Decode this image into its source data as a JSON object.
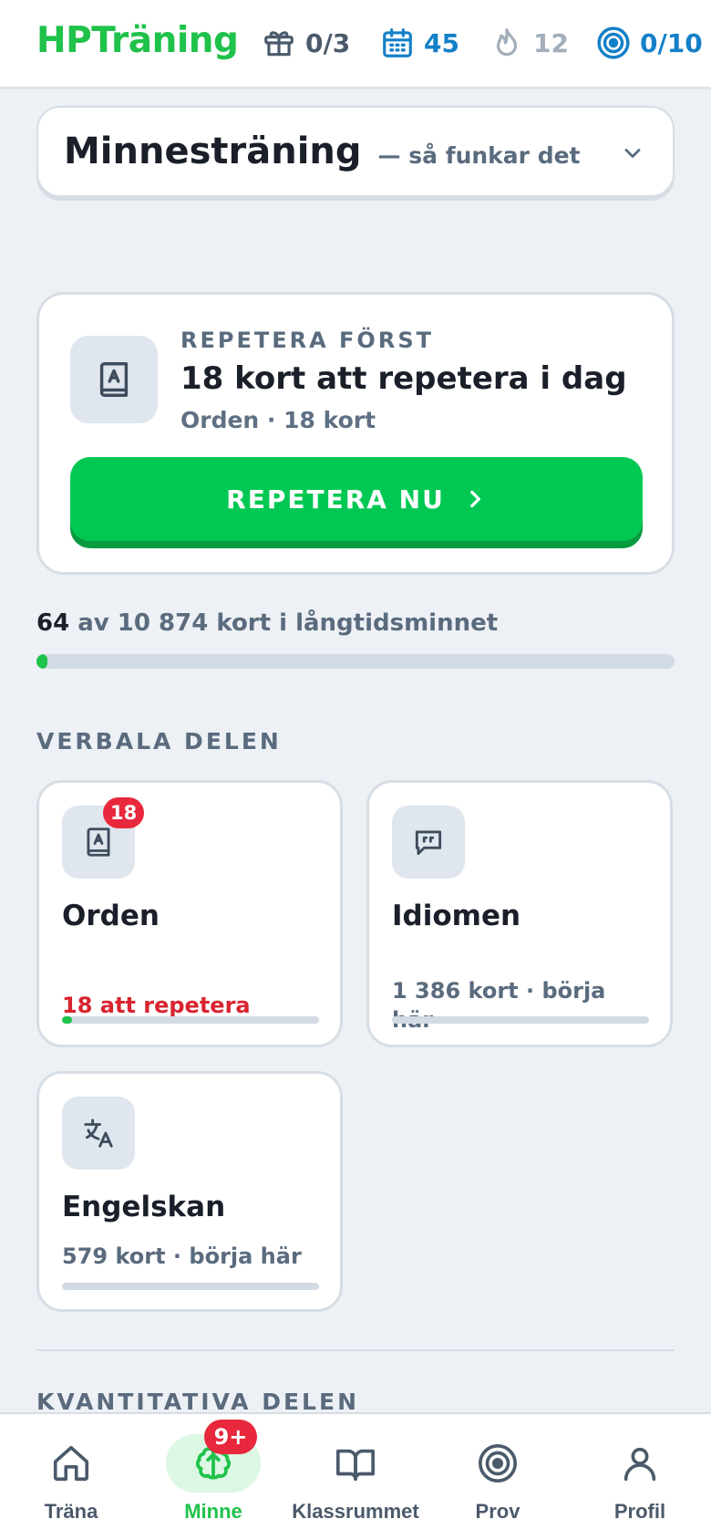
{
  "header": {
    "brand": "HPTräning",
    "stats": {
      "gifts": "0/3",
      "calendar": "45",
      "streak": "12",
      "goal": "0/10"
    },
    "icons": {
      "gifts": "gift-icon",
      "calendar": "calendar-icon",
      "streak": "flame-icon",
      "goal": "target-icon"
    }
  },
  "intro": {
    "title": "Minnesträning",
    "subtitle": "— så funkar det",
    "toggle_icon": "chevron-down-icon"
  },
  "review": {
    "kicker": "REPETERA FÖRST",
    "title": "18 kort att repetera i dag",
    "meta": "Orden · 18 kort",
    "button_label": "REPETERA NU",
    "icon": "book-icon",
    "button_icon": "chevron-right-icon"
  },
  "longterm": {
    "count": "64",
    "text": "av 10 874 kort i långtidsminnet",
    "progress": 0.006
  },
  "sections": {
    "verbal": "VERBALA DELEN",
    "quant": "KVANTITATIVA DELEN"
  },
  "decks": [
    {
      "title": "Orden",
      "status": "18 att repetera",
      "badge": "18",
      "progress": 0.04,
      "icon": "book-icon"
    },
    {
      "title": "Idiomen",
      "status": "1 386 kort · börja här",
      "progress": 0,
      "icon": "quote-bubble-icon"
    },
    {
      "title": "Engelskan",
      "status": "579 kort · börja här",
      "progress": 0,
      "icon": "translate-icon"
    }
  ],
  "nav": {
    "items": [
      {
        "label": "Träna",
        "icon": "home-icon"
      },
      {
        "label": "Minne",
        "icon": "brain-icon",
        "badge": "9+",
        "active": true
      },
      {
        "label": "Klassrummet",
        "icon": "open-book-icon"
      },
      {
        "label": "Prov",
        "icon": "target-icon"
      },
      {
        "label": "Profil",
        "icon": "user-icon"
      }
    ]
  },
  "colors": {
    "brand": "#1fc24a",
    "primary_button": "#00c853",
    "accent_blue": "#1480c8",
    "badge_red": "#e8283c",
    "due_red": "#d8242f"
  }
}
